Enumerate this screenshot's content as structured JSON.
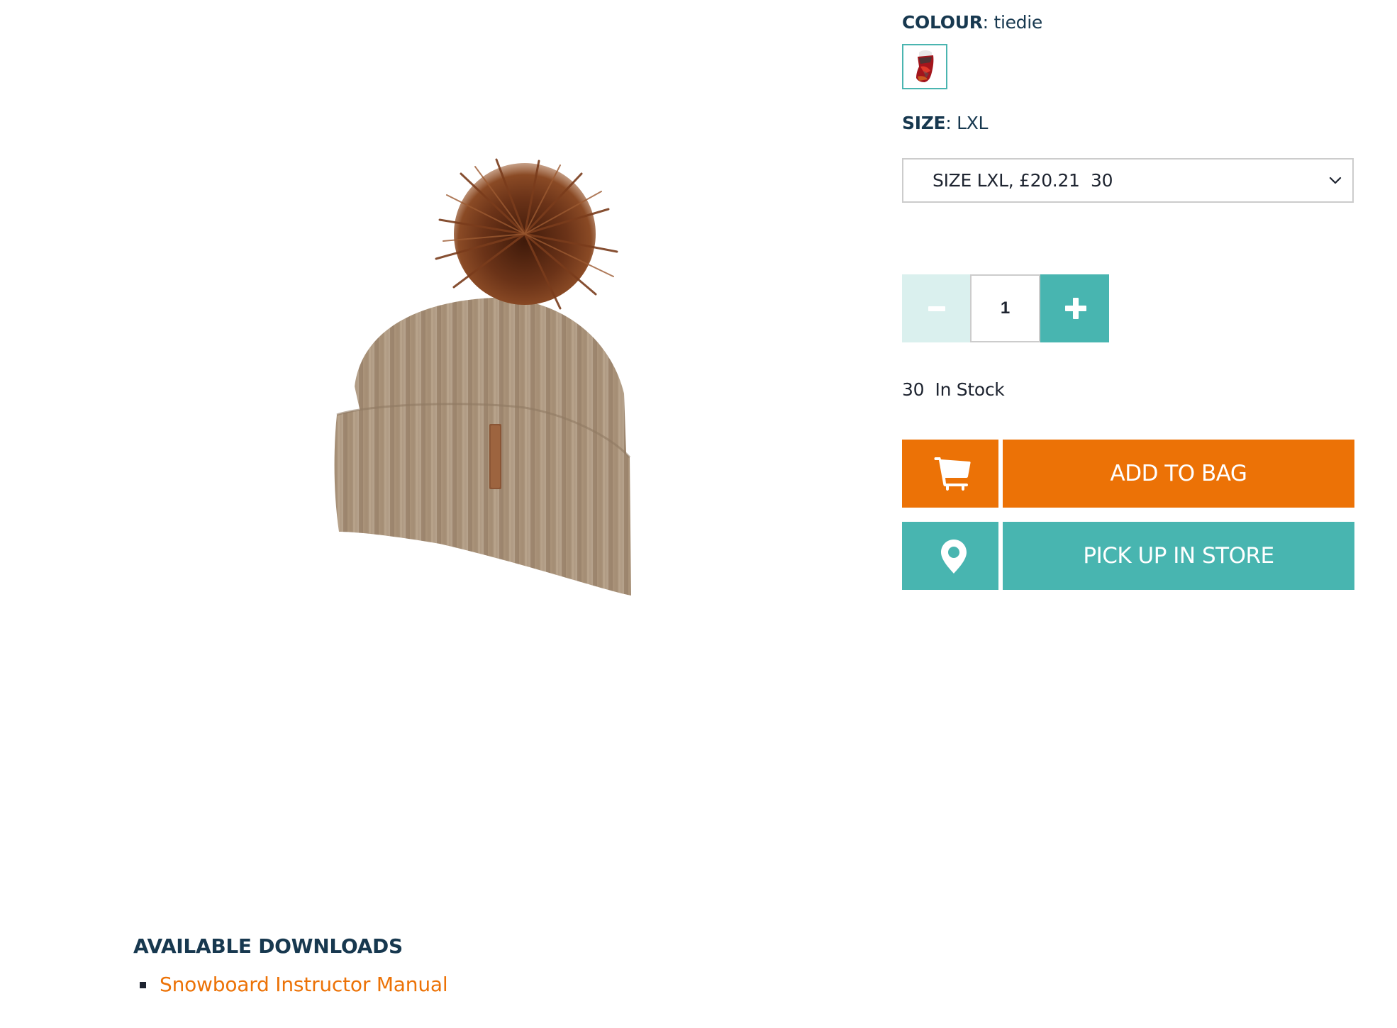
{
  "product": {
    "image_alt": "Beige ribbed knit beanie with brown fur pom-pom",
    "colors": {
      "hat_knit": "#a8927a",
      "pompom": "#6b3318",
      "tag": "#8a5535"
    }
  },
  "colour": {
    "label": "COLOUR",
    "separator": ":",
    "value": "tiedie",
    "swatches": [
      {
        "name": "tiedie",
        "selected": true
      }
    ]
  },
  "size": {
    "label": "SIZE",
    "separator": ":",
    "value": "LXL",
    "select": {
      "selected_option": "SIZE LXL, £20.21  30",
      "icon": "chevron-down-icon"
    }
  },
  "quantity": {
    "decrement_icon": "minus-icon",
    "value": "1",
    "increment_icon": "plus-icon"
  },
  "stock": {
    "count": "30",
    "text": "30  In Stock"
  },
  "actions": {
    "add_to_bag": {
      "label": "ADD TO BAG",
      "icon": "cart-icon"
    },
    "pick_up": {
      "label": "PICK UP IN STORE",
      "icon": "location-pin-icon"
    }
  },
  "downloads": {
    "title": "AVAILABLE DOWNLOADS",
    "items": [
      {
        "label": "Snowboard Instructor Manual"
      }
    ]
  },
  "theme": {
    "accent_orange": "#ec7206",
    "accent_teal": "#48b5b0",
    "teal_light": "#daf0ee",
    "heading_navy": "#17384f",
    "border_gray": "#cccccc"
  }
}
